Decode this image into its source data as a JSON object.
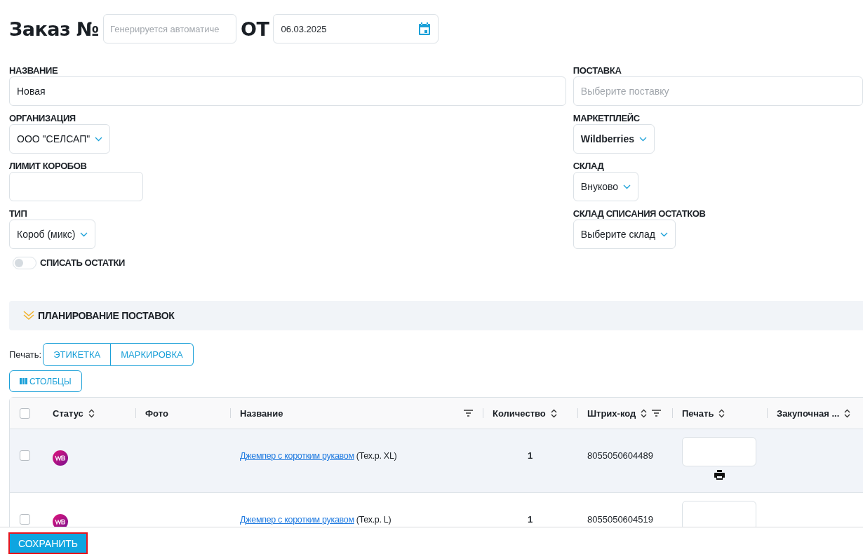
{
  "header": {
    "title": "Заказ №",
    "number_placeholder": "Генерируется автоматиче",
    "date_label": "ОТ",
    "date": "06.03.2025"
  },
  "left_fields": [
    {
      "kind": "text",
      "label": "НАЗВАНИЕ",
      "value": "Новая"
    },
    {
      "kind": "select",
      "label": "ОРГАНИЗАЦИЯ",
      "value": "ООО \"СЕЛСАП\""
    },
    {
      "kind": "text",
      "label": "ЛИМИТ КОРОБОВ"
    },
    {
      "kind": "select",
      "label": "ТИП",
      "value": "Короб (микс)"
    }
  ],
  "right_fields": [
    {
      "kind": "text",
      "label": "ПОСТАВКА",
      "placeholder": "Выберите поставку"
    },
    {
      "kind": "select",
      "label": "МАРКЕТПЛЕЙС",
      "value": "Wildberries",
      "bold": true
    },
    {
      "kind": "select",
      "label": "СКЛАД",
      "value": "Внуково"
    },
    {
      "kind": "select",
      "label": "СКЛАД СПИСАНИЯ ОСТАТКОВ",
      "value": "Выберите склад"
    }
  ],
  "toggle": {
    "label": "СПИСАТЬ ОСТАТКИ",
    "on": false
  },
  "section": {
    "title": "ПЛАНИРОВАНИЕ ПОСТАВОК",
    "expanded": true
  },
  "print": {
    "label": "Печать:",
    "buttons": [
      "ЭТИКЕТКА",
      "МАРКИРОВКА"
    ]
  },
  "columns_button": "СТОЛБЦЫ",
  "table": {
    "columns": [
      {
        "kind": "checkbox",
        "checked": false
      },
      {
        "kind": "text",
        "label": "Статус",
        "sortable": true,
        "filterable": false
      },
      {
        "kind": "text",
        "label": "Фото",
        "sortable": false,
        "filterable": false
      },
      {
        "kind": "text",
        "label": "Название",
        "sortable": false,
        "filterable": true
      },
      {
        "kind": "text",
        "label": "Количество",
        "sortable": true,
        "filterable": false
      },
      {
        "kind": "text",
        "label": "Штрих-код",
        "sortable": true,
        "filterable": true
      },
      {
        "kind": "text",
        "label": "Печать",
        "sortable": true,
        "filterable": false
      },
      {
        "kind": "text",
        "label": "Закупочная ...",
        "sortable": true,
        "filterable": false
      }
    ],
    "rows": [
      {
        "checked": false,
        "hovered": true,
        "name": "Джемпер с коротким рукавом",
        "size": "(Тех.р. XL)",
        "quantity": "1",
        "barcode": "8055050604489"
      },
      {
        "checked": false,
        "hovered": false,
        "name": "Джемпер с коротким рукавом",
        "size": "(Тех.р. L)",
        "quantity": "1",
        "barcode": "8055050604519"
      }
    ]
  },
  "save_button": "СОХРАНИТЬ"
}
